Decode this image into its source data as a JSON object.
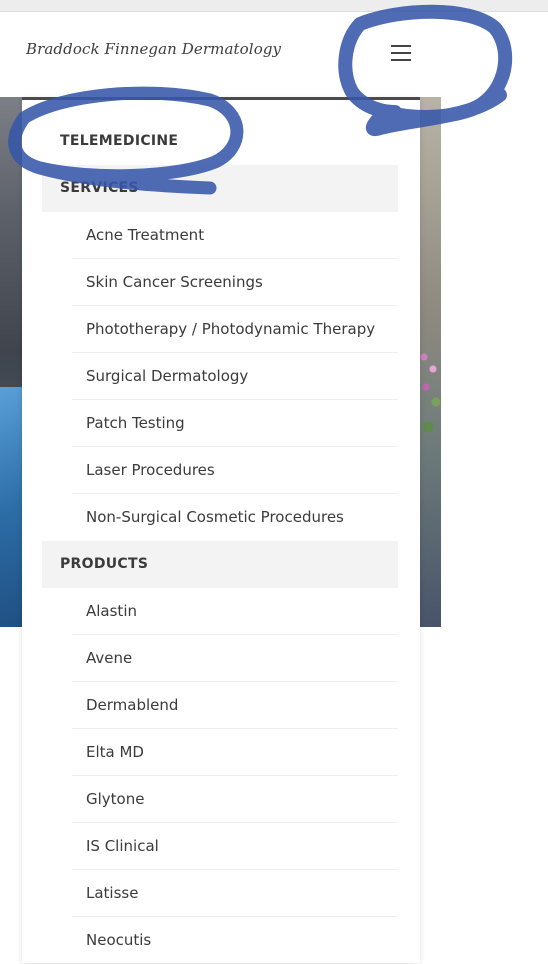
{
  "header": {
    "logo_text": "Braddock Finnegan Dermatology",
    "menu_icon": "hamburger-menu-icon"
  },
  "menu": {
    "telemedicine": "TELEMEDICINE",
    "services": {
      "label": "SERVICES",
      "items": [
        "Acne Treatment",
        "Skin Cancer Screenings",
        "Phototherapy / Photodynamic Therapy",
        "Surgical Dermatology",
        "Patch Testing",
        "Laser Procedures",
        "Non-Surgical Cosmetic Procedures"
      ]
    },
    "products": {
      "label": "PRODUCTS",
      "items": [
        "Alastin",
        "Avene",
        "Dermablend",
        "Elta MD",
        "Glytone",
        "IS Clinical",
        "Latisse",
        "Neocutis"
      ]
    }
  },
  "colors": {
    "annotation_marker": "#3557a8",
    "menu_top_border": "#4b4b4b",
    "section_shade": "#f3f3f3"
  }
}
